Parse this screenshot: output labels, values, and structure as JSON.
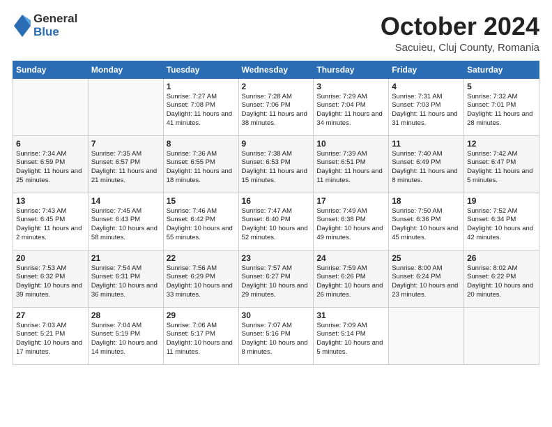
{
  "header": {
    "logo_general": "General",
    "logo_blue": "Blue",
    "month_title": "October 2024",
    "subtitle": "Sacuieu, Cluj County, Romania"
  },
  "columns": [
    "Sunday",
    "Monday",
    "Tuesday",
    "Wednesday",
    "Thursday",
    "Friday",
    "Saturday"
  ],
  "weeks": [
    [
      {
        "day": "",
        "content": ""
      },
      {
        "day": "",
        "content": ""
      },
      {
        "day": "1",
        "content": "Sunrise: 7:27 AM\nSunset: 7:08 PM\nDaylight: 11 hours and 41 minutes."
      },
      {
        "day": "2",
        "content": "Sunrise: 7:28 AM\nSunset: 7:06 PM\nDaylight: 11 hours and 38 minutes."
      },
      {
        "day": "3",
        "content": "Sunrise: 7:29 AM\nSunset: 7:04 PM\nDaylight: 11 hours and 34 minutes."
      },
      {
        "day": "4",
        "content": "Sunrise: 7:31 AM\nSunset: 7:03 PM\nDaylight: 11 hours and 31 minutes."
      },
      {
        "day": "5",
        "content": "Sunrise: 7:32 AM\nSunset: 7:01 PM\nDaylight: 11 hours and 28 minutes."
      }
    ],
    [
      {
        "day": "6",
        "content": "Sunrise: 7:34 AM\nSunset: 6:59 PM\nDaylight: 11 hours and 25 minutes."
      },
      {
        "day": "7",
        "content": "Sunrise: 7:35 AM\nSunset: 6:57 PM\nDaylight: 11 hours and 21 minutes."
      },
      {
        "day": "8",
        "content": "Sunrise: 7:36 AM\nSunset: 6:55 PM\nDaylight: 11 hours and 18 minutes."
      },
      {
        "day": "9",
        "content": "Sunrise: 7:38 AM\nSunset: 6:53 PM\nDaylight: 11 hours and 15 minutes."
      },
      {
        "day": "10",
        "content": "Sunrise: 7:39 AM\nSunset: 6:51 PM\nDaylight: 11 hours and 11 minutes."
      },
      {
        "day": "11",
        "content": "Sunrise: 7:40 AM\nSunset: 6:49 PM\nDaylight: 11 hours and 8 minutes."
      },
      {
        "day": "12",
        "content": "Sunrise: 7:42 AM\nSunset: 6:47 PM\nDaylight: 11 hours and 5 minutes."
      }
    ],
    [
      {
        "day": "13",
        "content": "Sunrise: 7:43 AM\nSunset: 6:45 PM\nDaylight: 11 hours and 2 minutes."
      },
      {
        "day": "14",
        "content": "Sunrise: 7:45 AM\nSunset: 6:43 PM\nDaylight: 10 hours and 58 minutes."
      },
      {
        "day": "15",
        "content": "Sunrise: 7:46 AM\nSunset: 6:42 PM\nDaylight: 10 hours and 55 minutes."
      },
      {
        "day": "16",
        "content": "Sunrise: 7:47 AM\nSunset: 6:40 PM\nDaylight: 10 hours and 52 minutes."
      },
      {
        "day": "17",
        "content": "Sunrise: 7:49 AM\nSunset: 6:38 PM\nDaylight: 10 hours and 49 minutes."
      },
      {
        "day": "18",
        "content": "Sunrise: 7:50 AM\nSunset: 6:36 PM\nDaylight: 10 hours and 45 minutes."
      },
      {
        "day": "19",
        "content": "Sunrise: 7:52 AM\nSunset: 6:34 PM\nDaylight: 10 hours and 42 minutes."
      }
    ],
    [
      {
        "day": "20",
        "content": "Sunrise: 7:53 AM\nSunset: 6:32 PM\nDaylight: 10 hours and 39 minutes."
      },
      {
        "day": "21",
        "content": "Sunrise: 7:54 AM\nSunset: 6:31 PM\nDaylight: 10 hours and 36 minutes."
      },
      {
        "day": "22",
        "content": "Sunrise: 7:56 AM\nSunset: 6:29 PM\nDaylight: 10 hours and 33 minutes."
      },
      {
        "day": "23",
        "content": "Sunrise: 7:57 AM\nSunset: 6:27 PM\nDaylight: 10 hours and 29 minutes."
      },
      {
        "day": "24",
        "content": "Sunrise: 7:59 AM\nSunset: 6:26 PM\nDaylight: 10 hours and 26 minutes."
      },
      {
        "day": "25",
        "content": "Sunrise: 8:00 AM\nSunset: 6:24 PM\nDaylight: 10 hours and 23 minutes."
      },
      {
        "day": "26",
        "content": "Sunrise: 8:02 AM\nSunset: 6:22 PM\nDaylight: 10 hours and 20 minutes."
      }
    ],
    [
      {
        "day": "27",
        "content": "Sunrise: 7:03 AM\nSunset: 5:21 PM\nDaylight: 10 hours and 17 minutes."
      },
      {
        "day": "28",
        "content": "Sunrise: 7:04 AM\nSunset: 5:19 PM\nDaylight: 10 hours and 14 minutes."
      },
      {
        "day": "29",
        "content": "Sunrise: 7:06 AM\nSunset: 5:17 PM\nDaylight: 10 hours and 11 minutes."
      },
      {
        "day": "30",
        "content": "Sunrise: 7:07 AM\nSunset: 5:16 PM\nDaylight: 10 hours and 8 minutes."
      },
      {
        "day": "31",
        "content": "Sunrise: 7:09 AM\nSunset: 5:14 PM\nDaylight: 10 hours and 5 minutes."
      },
      {
        "day": "",
        "content": ""
      },
      {
        "day": "",
        "content": ""
      }
    ]
  ]
}
